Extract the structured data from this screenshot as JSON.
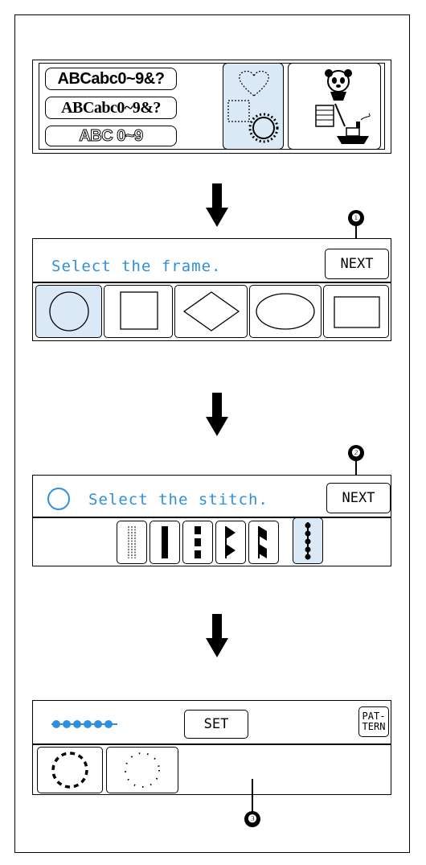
{
  "screen1": {
    "font_samples": [
      "ABCabc0~9&?",
      "ABCabc0~9&?",
      "ABC 0~9"
    ],
    "frame_category": "frame-pattern-tile",
    "character_category": "character-tile"
  },
  "screen2": {
    "prompt": "Select the frame.",
    "next_label": "NEXT",
    "callout": "❶",
    "frames": [
      "circle",
      "square",
      "diamond",
      "oval",
      "rectangle"
    ],
    "selected_frame": "circle"
  },
  "screen3": {
    "prompt": "Select the stitch.",
    "next_label": "NEXT",
    "callout": "❷",
    "selected_stitch_index": 5
  },
  "screen4": {
    "set_label": "SET",
    "pattern_label_line1": "PAT-",
    "pattern_label_line2": "TERN",
    "callout": "❸"
  },
  "colors": {
    "lcd_text": "#2c8fe0",
    "selected_bg": "#dbe9f7"
  }
}
